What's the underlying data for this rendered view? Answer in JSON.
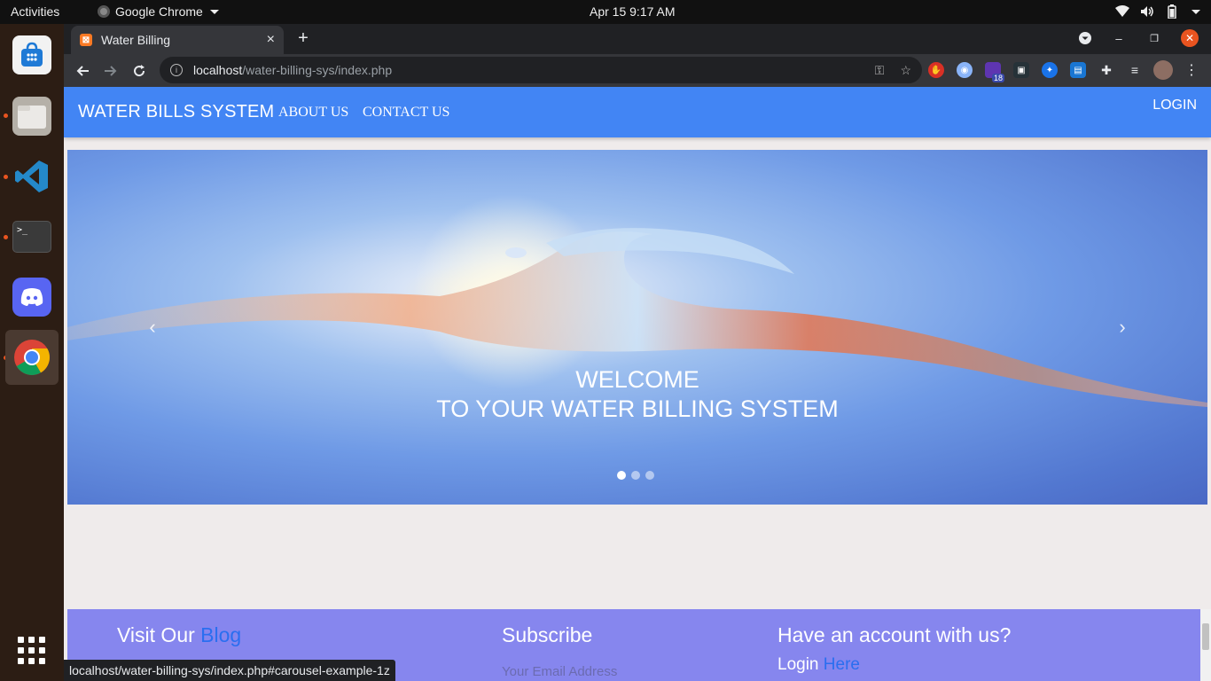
{
  "system": {
    "activities": "Activities",
    "app_name": "Google Chrome",
    "clock": "Apr 15  9:17 AM"
  },
  "dock": {
    "items": [
      {
        "name": "software"
      },
      {
        "name": "files"
      },
      {
        "name": "vscode"
      },
      {
        "name": "terminal"
      },
      {
        "name": "discord"
      },
      {
        "name": "chrome"
      }
    ],
    "terminal_glyph": ">_"
  },
  "browser": {
    "tab_title": "Water Billing",
    "url_host": "localhost",
    "url_path": "/water-billing-sys/index.php",
    "extension_badge": "18",
    "status_url": "localhost/water-billing-sys/index.php#carousel-example-1z"
  },
  "site": {
    "brand": "WATER BILLS SYSTEM",
    "nav": [
      "ABOUT US",
      "CONTACT US"
    ],
    "login": "LOGIN",
    "carousel": {
      "line1": "WELCOME",
      "line2": "TO YOUR WATER BILLING SYSTEM",
      "prev": "‹",
      "next": "›",
      "slides": 3,
      "active_slide": 1
    },
    "footer": {
      "col1_text": "Visit Our ",
      "col1_link": "Blog",
      "col2_title": "Subscribe",
      "col2_placeholder": "Your Email Address",
      "col3_title": "Have an account with us?",
      "col3_text": "Login ",
      "col3_link": "Here"
    }
  },
  "colors": {
    "navbar": "#4285f4",
    "footer": "#8686ee",
    "link": "#2a6ef0",
    "page_bg": "#efebeb"
  }
}
